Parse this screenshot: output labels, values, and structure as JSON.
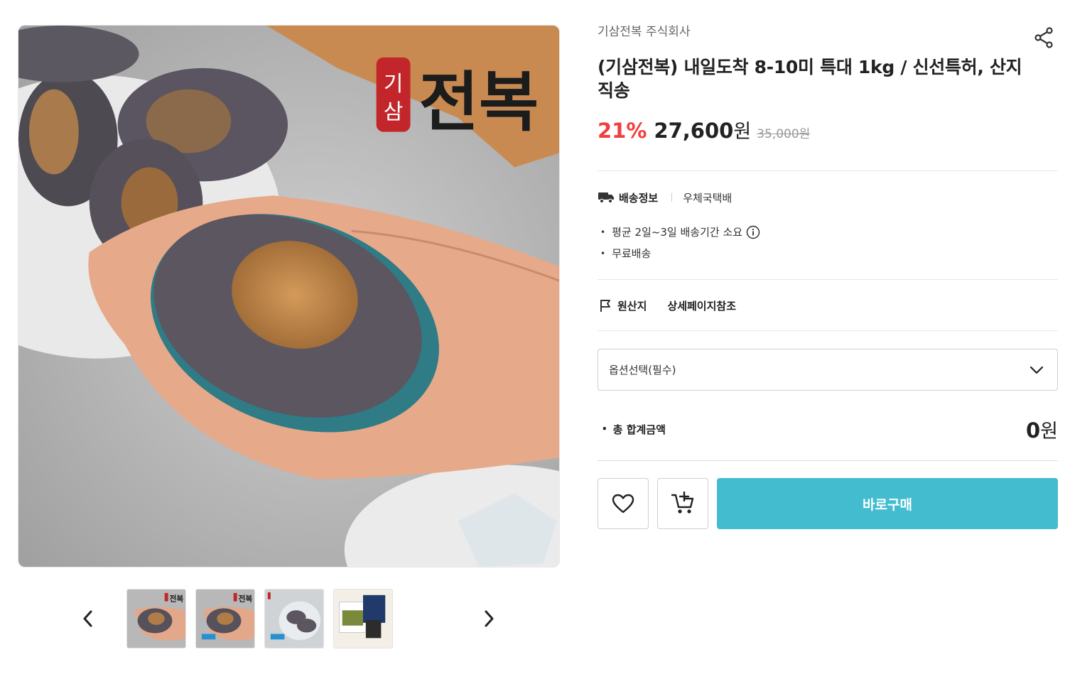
{
  "gallery": {
    "main_image_label": "main-product-photo",
    "logo_small": "기삼",
    "logo_big": "전복",
    "thumbnails": [
      {
        "label": "thumbnail-1"
      },
      {
        "label": "thumbnail-2"
      },
      {
        "label": "thumbnail-3"
      },
      {
        "label": "thumbnail-4"
      }
    ],
    "icons": {
      "prev": "chevron-left-icon",
      "next": "chevron-right-icon"
    }
  },
  "product": {
    "seller": "기삼전복 주식회사",
    "title": "(기삼전복) 내일도착 8-10미 특대 1kg / 신선특허, 산지직송",
    "discount": "21%",
    "price": "27,600",
    "price_unit": "원",
    "original_price": "35,000원"
  },
  "shipping": {
    "label": "배송정보",
    "carrier": "우체국택배",
    "notes": [
      "평균 2일~3일 배송기간 소요",
      "무료배송"
    ]
  },
  "origin": {
    "label": "원산지",
    "value": "상세페이지참조"
  },
  "option": {
    "placeholder": "옵션선택(필수)"
  },
  "total": {
    "label": "총 합계금액",
    "amount": "0",
    "unit": "원"
  },
  "actions": {
    "buy_label": "바로구매"
  },
  "colors": {
    "discount": "#f23e3e",
    "buy_button": "#43bccf"
  }
}
